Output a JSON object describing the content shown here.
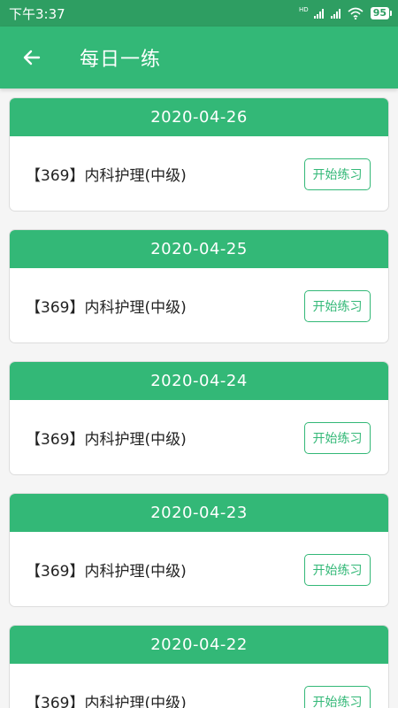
{
  "status_bar": {
    "time": "下午3:37",
    "network_label": "HD",
    "battery": "95",
    "icons": [
      "signal-icon",
      "signal-icon",
      "wifi-icon",
      "battery-icon"
    ]
  },
  "header": {
    "title": "每日一练",
    "back_icon": "arrow-left-icon"
  },
  "colors": {
    "primary": "#33b877",
    "status_bar": "#2e9e62",
    "background": "#f5f5f5",
    "text": "#222222"
  },
  "practices": [
    {
      "date": "2020-04-26",
      "title": "【369】内科护理(中级)",
      "button": "开始练习"
    },
    {
      "date": "2020-04-25",
      "title": "【369】内科护理(中级)",
      "button": "开始练习"
    },
    {
      "date": "2020-04-24",
      "title": "【369】内科护理(中级)",
      "button": "开始练习"
    },
    {
      "date": "2020-04-23",
      "title": "【369】内科护理(中级)",
      "button": "开始练习"
    },
    {
      "date": "2020-04-22",
      "title": "【369】内科护理(中级)",
      "button": "开始练习"
    }
  ]
}
